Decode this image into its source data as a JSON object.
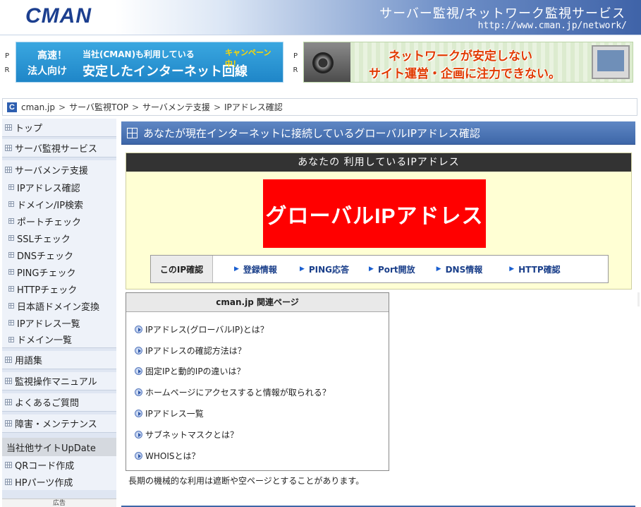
{
  "header": {
    "logo": "CMAN",
    "title": "サーバー監視/ネットワーク監視サービス",
    "url": "http://www.cman.jp/network/"
  },
  "ads": {
    "pr_p": "P",
    "pr_r": "R",
    "ad1": {
      "line1": "高速！",
      "line2": "法人向け",
      "main_small": "当社(CMAN)も利用している",
      "main_large": "安定したインターネット回線",
      "campaign": "キャンペーン中！"
    },
    "ad2": {
      "line1": "ネットワークが安定しない",
      "line2": "サイト運営・企画に注力できない。"
    }
  },
  "breadcrumb": {
    "icon": "C",
    "items": [
      "cman.jp",
      "サーバ監視TOP",
      "サーバメンテ支援",
      "IPアドレス確認"
    ],
    "separator": ">"
  },
  "sidebar": {
    "items": [
      {
        "label": "トップ"
      },
      {
        "label": "サーバ監視サービス"
      },
      {
        "label": "サーバメンテ支援"
      }
    ],
    "sub_items": [
      {
        "label": "IPアドレス確認"
      },
      {
        "label": "ドメイン/IP検索"
      },
      {
        "label": "ポートチェック"
      },
      {
        "label": "SSLチェック"
      },
      {
        "label": "DNSチェック"
      },
      {
        "label": "PINGチェック"
      },
      {
        "label": "HTTPチェック"
      },
      {
        "label": "日本語ドメイン変換"
      },
      {
        "label": "IPアドレス一覧"
      },
      {
        "label": "ドメイン一覧"
      }
    ],
    "items2": [
      {
        "label": "用語集"
      },
      {
        "label": "監視操作マニュアル"
      },
      {
        "label": "よくあるご質問"
      },
      {
        "label": "障害・メンテナンス"
      }
    ],
    "heading": "当社他サイトUpDate",
    "sub_items2": [
      {
        "label": "QRコード作成"
      },
      {
        "label": "HPパーツ作成"
      }
    ],
    "ad_label": "広告"
  },
  "main": {
    "title": "あなたが現在インターネットに接続しているグローバルIPアドレス確認",
    "ip_heading": "あなたの 利用しているIPアドレス",
    "ip_value": "グローバルIPアドレス",
    "tools_label": "このIP確認",
    "tools": [
      {
        "label": "登録情報"
      },
      {
        "label": "PING応答"
      },
      {
        "label": "Port開放"
      },
      {
        "label": "DNS情報"
      },
      {
        "label": "HTTP確認"
      }
    ],
    "related_title": "cman.jp 関連ページ",
    "related": [
      {
        "label": "IPアドレス(グローバルIP)とは？"
      },
      {
        "label": "IPアドレスの確認方法は？"
      },
      {
        "label": "固定IPと動的IPの違いは？"
      },
      {
        "label": "ホームページにアクセスすると情報が取られる？"
      },
      {
        "label": "IPアドレス一覧"
      },
      {
        "label": "サブネットマスクとは？"
      },
      {
        "label": "WHOISとは？"
      }
    ],
    "note": "長期の機械的な利用は遮断や空ページとすることがあります。"
  },
  "colors": {
    "accent": "#3d66a8",
    "ip_box_bg": "#ffffd4",
    "ip_value_bg": "#ff0000",
    "sidebar_bg": "#eef2f9"
  }
}
